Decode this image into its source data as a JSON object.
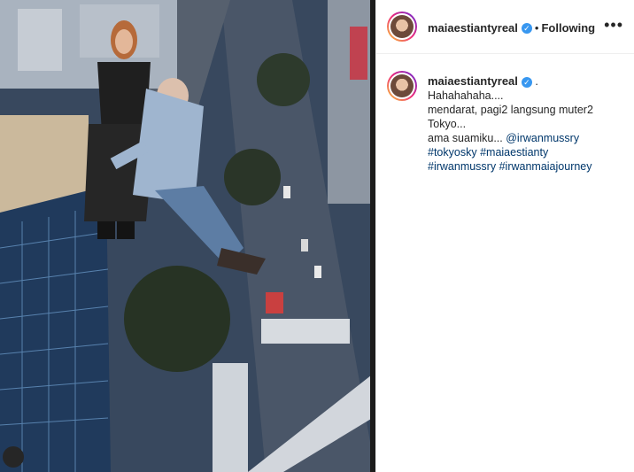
{
  "post": {
    "username": "maiaestiantyreal",
    "follow_status": "Following",
    "separator": "•",
    "more_icon": "more-horizontal-icon"
  },
  "caption": {
    "username": "maiaestiantyreal",
    "trailing_dot": ".",
    "lines": [
      "Hahahahaha....",
      "mendarat, pagi2 langsung muter2",
      "Tokyo..."
    ],
    "mention_prefix": "ama suamiku... ",
    "mention": "@irwanmussry",
    "hashtags_line1": [
      "#tokyosky",
      "#maiaestianty"
    ],
    "hashtags_line2": [
      "#irwanmussry",
      "#irwanmaiajourney"
    ]
  },
  "colors": {
    "accent_blue": "#3897f0",
    "link": "#00376b",
    "text": "#262626"
  }
}
